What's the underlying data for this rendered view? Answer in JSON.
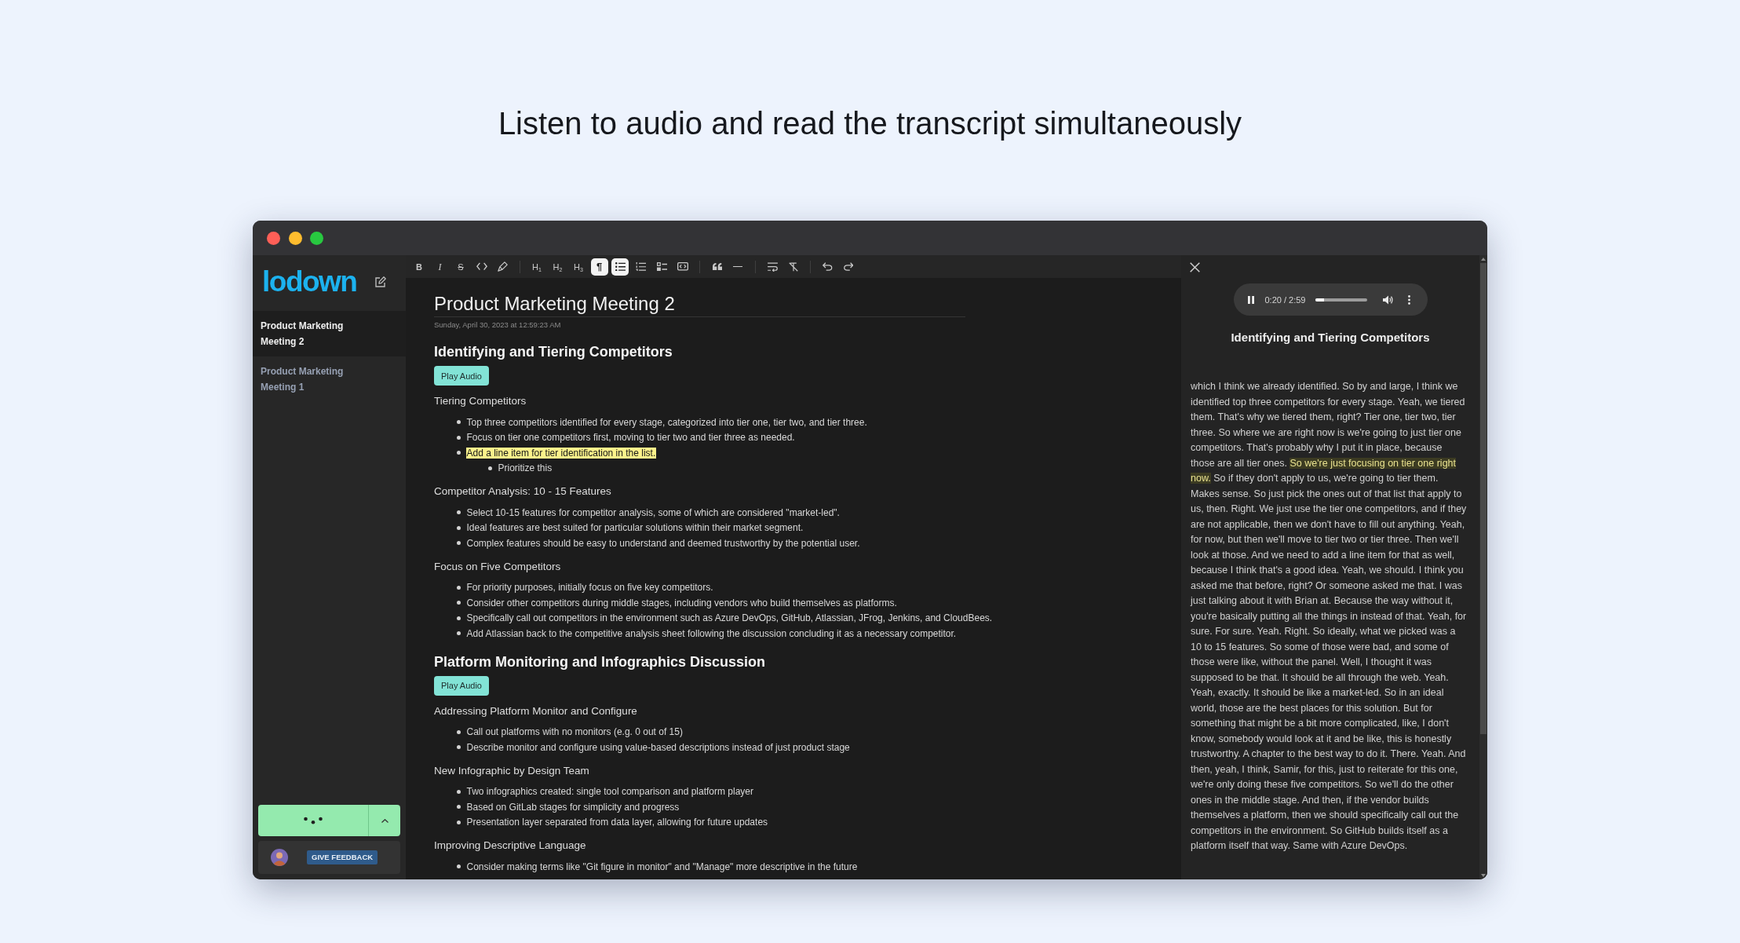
{
  "headline": "Listen to audio and read the transcript simultaneously",
  "sidebar": {
    "logo": "lodown",
    "notes": [
      {
        "title": "Product Marketing Meeting 2",
        "selected": true
      },
      {
        "title": "Product Marketing Meeting 1",
        "selected": false
      }
    ],
    "feedback_label": "GIVE FEEDBACK"
  },
  "toolbar": {
    "groups": [
      {
        "buttons": [
          {
            "kind": "bold",
            "label": "B",
            "active": false
          },
          {
            "kind": "italic",
            "label": "I",
            "active": false
          },
          {
            "kind": "strike",
            "label": "S",
            "active": false
          },
          {
            "kind": "code",
            "active": false
          },
          {
            "kind": "highlight",
            "active": false
          }
        ]
      },
      {
        "buttons": [
          {
            "kind": "heading",
            "label": "H$_{1}$",
            "active": false
          },
          {
            "kind": "heading",
            "label": "H$_{2}$",
            "active": false
          },
          {
            "kind": "heading",
            "label": "H$_{3}$",
            "active": false
          },
          {
            "kind": "paragraph",
            "label": "¶",
            "active": true
          },
          {
            "kind": "bullet_list",
            "active": true
          },
          {
            "kind": "ordered_list",
            "active": false
          },
          {
            "kind": "task_list",
            "active": false
          },
          {
            "kind": "code_block",
            "active": false
          }
        ]
      },
      {
        "buttons": [
          {
            "kind": "quote",
            "active": false
          },
          {
            "kind": "rule",
            "active": false
          }
        ]
      },
      {
        "buttons": [
          {
            "kind": "hard_break",
            "active": false
          },
          {
            "kind": "clear_format",
            "active": false
          }
        ]
      },
      {
        "buttons": [
          {
            "kind": "undo",
            "active": false
          },
          {
            "kind": "redo",
            "active": false
          }
        ]
      }
    ]
  },
  "document": {
    "title": "Product Marketing Meeting 2",
    "date": "Sunday, April 30, 2023 at 12:59:23 AM",
    "sections": [
      {
        "heading": "Identifying and Tiering Competitors",
        "button": "Play Audio",
        "topics": [
          {
            "heading": "Tiering Competitors",
            "items": [
              {
                "text": "Top three competitors identified for every stage, categorized into tier one, tier two, and tier three.",
                "highlighted": false
              },
              {
                "text": "Focus on tier one competitors first, moving to tier two and tier three as needed.",
                "highlighted": false
              },
              {
                "text": "Add a line item for tier identification in the list.",
                "highlighted": true,
                "children": [
                  {
                    "text": "Prioritize this",
                    "highlighted": false
                  }
                ]
              }
            ]
          },
          {
            "heading": "Competitor Analysis: 10 - 15 Features",
            "items": [
              {
                "text": "Select 10-15 features for competitor analysis, some of which are considered \"market-led\".",
                "highlighted": false
              },
              {
                "text": "Ideal features are best suited for particular solutions within their market segment.",
                "highlighted": false
              },
              {
                "text": "Complex features should be easy to understand and deemed trustworthy by the potential user.",
                "highlighted": false
              }
            ]
          },
          {
            "heading": "Focus on Five Competitors",
            "items": [
              {
                "text": "For priority purposes, initially focus on five key competitors.",
                "highlighted": false
              },
              {
                "text": "Consider other competitors during middle stages, including vendors who build themselves as platforms.",
                "highlighted": false
              },
              {
                "text": "Specifically call out competitors in the environment such as Azure DevOps, GitHub, Atlassian, JFrog, Jenkins, and CloudBees.",
                "highlighted": false
              },
              {
                "text": "Add Atlassian back to the competitive analysis sheet following the discussion concluding it as a necessary competitor.",
                "highlighted": false
              }
            ]
          }
        ]
      },
      {
        "heading": "Platform Monitoring and Infographics Discussion",
        "button": "Play Audio",
        "topics": [
          {
            "heading": "Addressing Platform Monitor and Configure",
            "items": [
              {
                "text": "Call out platforms with no monitors (e.g. 0 out of 15)",
                "highlighted": false
              },
              {
                "text": "Describe monitor and configure using value-based descriptions instead of just product stage",
                "highlighted": false
              }
            ]
          },
          {
            "heading": "New Infographic by Design Team",
            "items": [
              {
                "text": "Two infographics created: single tool comparison and platform player",
                "highlighted": false
              },
              {
                "text": "Based on GitLab stages for simplicity and progress",
                "highlighted": false
              },
              {
                "text": "Presentation layer separated from data layer, allowing for future updates",
                "highlighted": false
              }
            ]
          },
          {
            "heading": "Improving Descriptive Language",
            "items": [
              {
                "text": "Consider making terms like \"Git figure in monitor\" and \"Manage\" more descriptive in the future",
                "highlighted": false
              }
            ]
          }
        ]
      }
    ]
  },
  "transcript_panel": {
    "player": {
      "playing": true,
      "time": "0:20 / 2:59",
      "level": 0.18
    },
    "title": "Identifying and Tiering Competitors",
    "segments": [
      {
        "text": "which I think we already identified. So by and large, I think we identified top three competitors for every stage. Yeah, we tiered them. That's why we tiered them, right? Tier one, tier two, tier three. So where we are right now is we're going to just tier one competitors. That's probably why I put it in place, because those are all tier ones.",
        "highlighted": false
      },
      {
        "text": "So we're just focusing on tier one right now.",
        "highlighted": true
      },
      {
        "text": "So if they don't apply to us, we're going to tier them. Makes sense. So just pick the ones out of that list that apply to us, then. Right. We just use the tier one competitors, and if they are not applicable, then we don't have to fill out anything. Yeah, for now, but then we'll move to tier two or tier three. Then we'll look at those. And we need to add a line item for that as well, because I think that's a good idea. Yeah, we should. I think you asked me that before, right? Or someone asked me that. I was just talking about it with Brian at. Because the way without it, you're basically putting all the things in instead of that. Yeah, for sure. For sure. Yeah. Right. So ideally, what we picked was a 10 to 15 features. So some of those were bad, and some of those were like, without the panel. Well, I thought it was supposed to be that. It should be all through the web. Yeah. Yeah, exactly. It should be like a market-led. So in an ideal world, those are the best places for this solution. But for something that might be a bit more complicated, like, I don't know, somebody would look at it and be like, this is honestly trustworthy. A chapter to the best way to do it. There. Yeah. And then, yeah, I think, Samir, for this, just to reiterate for this one, we're only doing these five competitors. So we'll do the other ones in the middle stage. And then, if the vendor builds themselves a platform, then we should specifically call out the competitors in the environment. So GitHub builds itself as a platform itself that way. Same with Azure DevOps.",
        "highlighted": false
      }
    ]
  }
}
